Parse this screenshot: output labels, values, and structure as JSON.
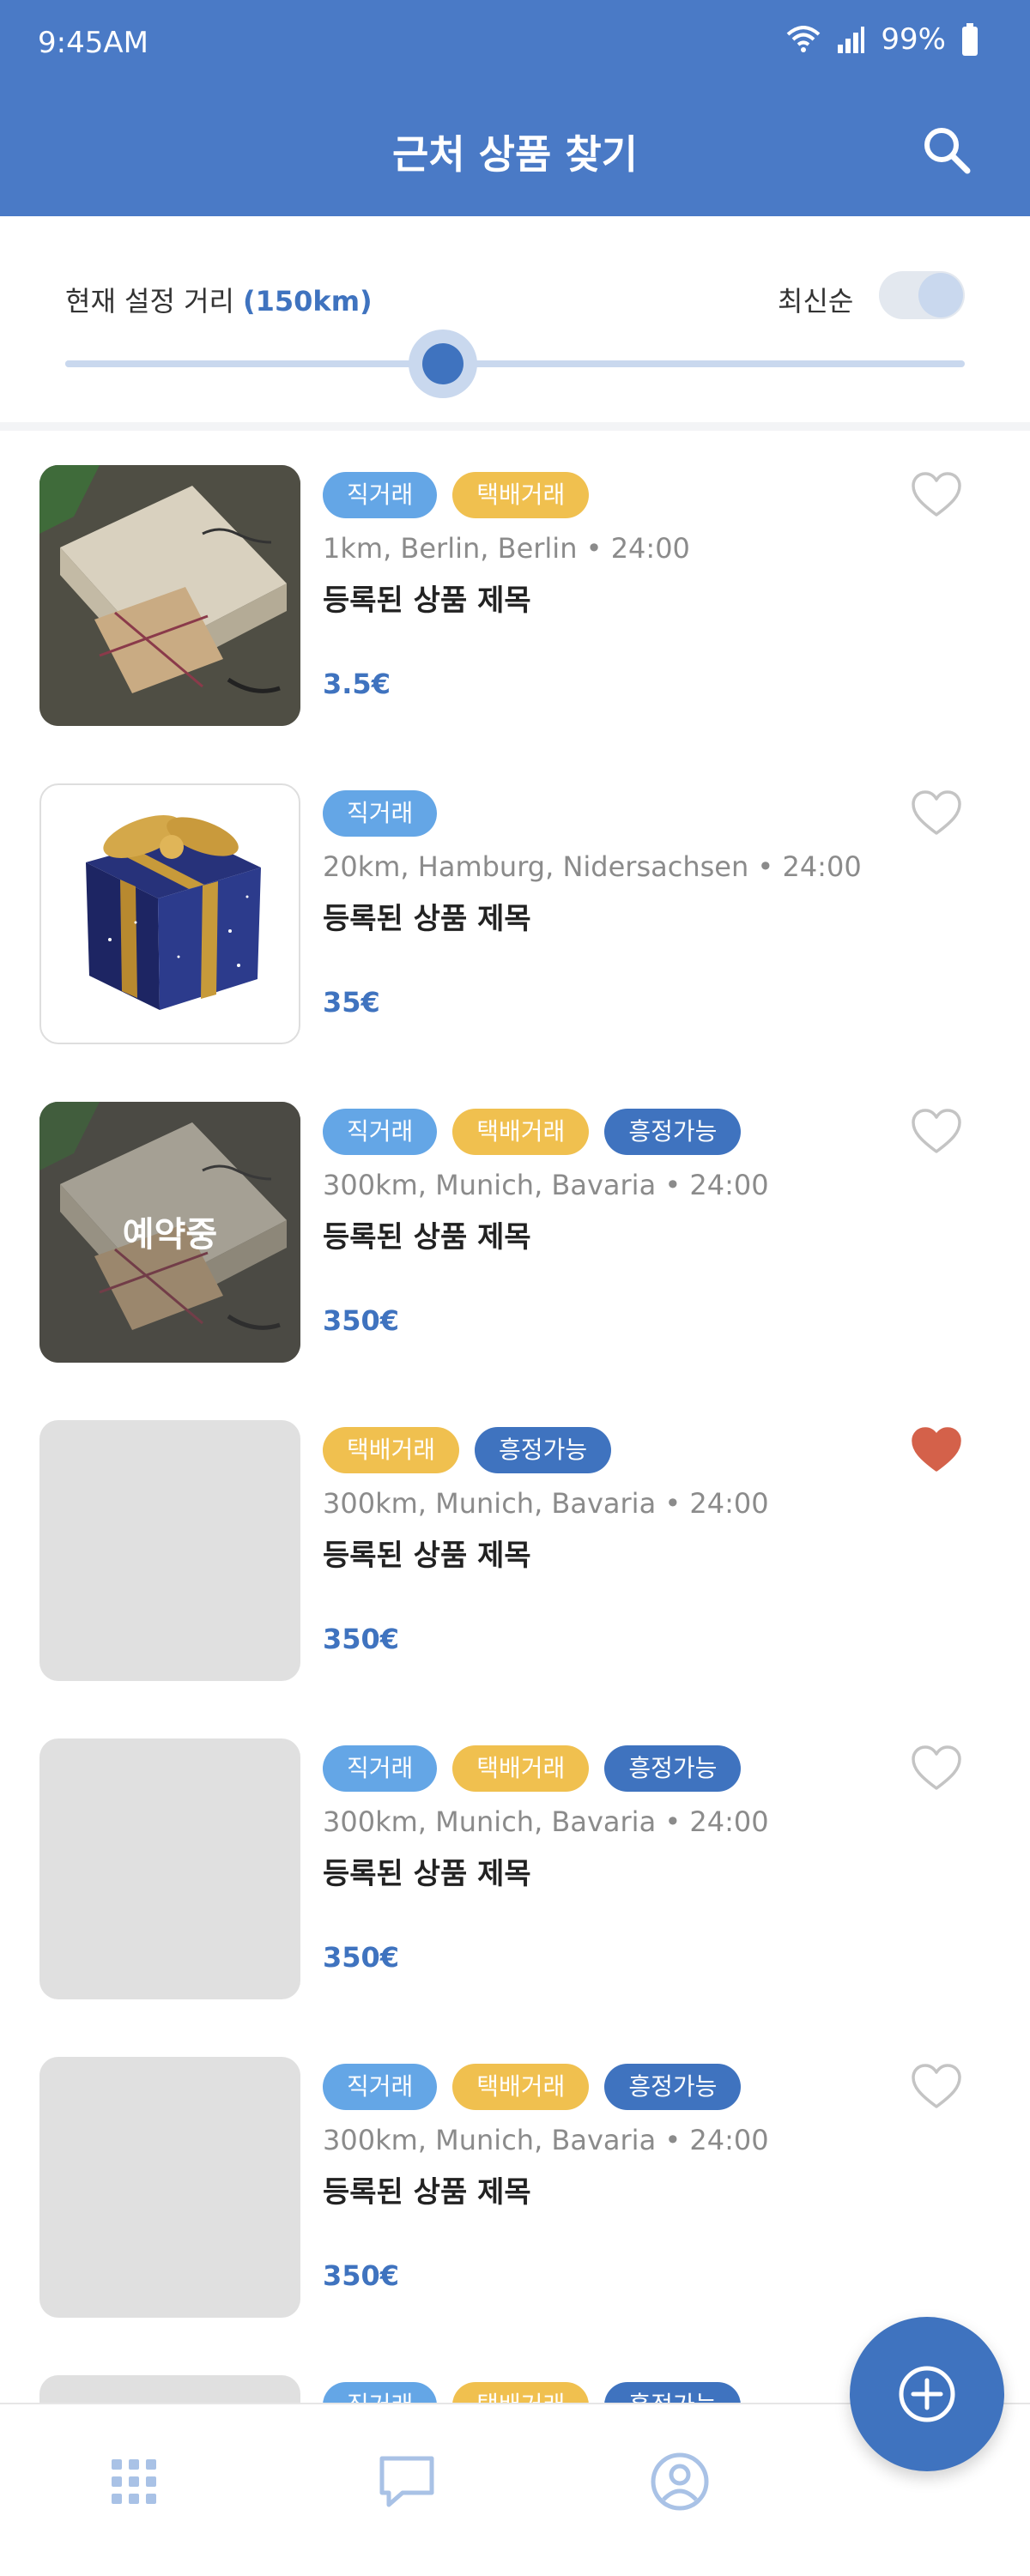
{
  "status_bar": {
    "time": "9:45AM",
    "battery": "99%"
  },
  "header": {
    "title": "근처 상품 찾기",
    "search_icon": "search-icon"
  },
  "filter": {
    "distance_label": "현재 설정 거리",
    "distance_value": "(150km)",
    "sort_label": "최신순",
    "sort_toggle_on": true,
    "slider_position": 0.42
  },
  "colors": {
    "header": "#4a7ac6",
    "accent": "#3f73bf",
    "tag_direct": "#64a6e6",
    "tag_delivery": "#f0c04f",
    "tag_nego": "#3f73bf",
    "heart_liked": "#d4614a"
  },
  "products": [
    {
      "tags": [
        "직거래",
        "택배거래"
      ],
      "location": "1km, Berlin, Berlin • 24:00",
      "title": "등록된 상품 제목",
      "price": "3.5€",
      "liked": false,
      "reserved": false,
      "image": "gift-wrapped-photo"
    },
    {
      "tags": [
        "직거래"
      ],
      "location": "20km, Hamburg, Nidersachsen • 24:00",
      "title": "등록된 상품 제목",
      "price": "35€",
      "liked": false,
      "reserved": false,
      "image": "gift-box-photo"
    },
    {
      "tags": [
        "직거래",
        "택배거래",
        "흥정가능"
      ],
      "location": "300km, Munich, Bavaria • 24:00",
      "title": "등록된 상품 제목",
      "price": "350€",
      "liked": false,
      "reserved": true,
      "reserved_label": "예약중",
      "image": "gift-wrapped-photo"
    },
    {
      "tags": [
        "택배거래",
        "흥정가능"
      ],
      "location": "300km, Munich, Bavaria • 24:00",
      "title": "등록된 상품 제목",
      "price": "350€",
      "liked": true,
      "reserved": false,
      "image": "placeholder"
    },
    {
      "tags": [
        "직거래",
        "택배거래",
        "흥정가능"
      ],
      "location": "300km, Munich, Bavaria • 24:00",
      "title": "등록된 상품 제목",
      "price": "350€",
      "liked": false,
      "reserved": false,
      "image": "placeholder"
    },
    {
      "tags": [
        "직거래",
        "택배거래",
        "흥정가능"
      ],
      "location": "300km, Munich, Bavaria • 24:00",
      "title": "등록된 상품 제목",
      "price": "350€",
      "liked": false,
      "reserved": false,
      "image": "placeholder"
    },
    {
      "tags": [
        "직거래",
        "택배거래",
        "흥정가능"
      ],
      "location": "",
      "title": "",
      "price": "",
      "liked": false,
      "reserved": false,
      "image": "placeholder"
    }
  ],
  "bottom_nav": [
    {
      "icon": "grid-icon"
    },
    {
      "icon": "chat-icon"
    },
    {
      "icon": "profile-icon"
    }
  ],
  "fab": {
    "icon": "add-icon"
  }
}
